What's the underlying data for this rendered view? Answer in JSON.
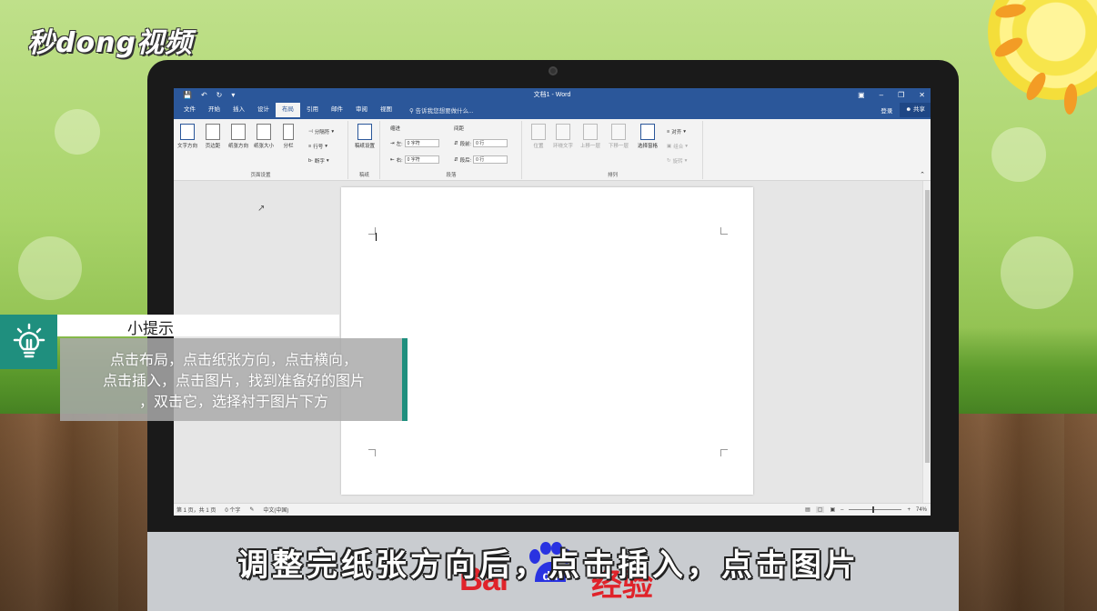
{
  "brand": {
    "logo_text": "秒dong视频"
  },
  "window": {
    "title": "文档1 - Word",
    "quick_access": [
      "save-icon",
      "undo-icon",
      "redo-icon",
      "customize-icon"
    ],
    "controls": [
      "ribbon-options-icon",
      "minimize-icon",
      "restore-icon",
      "close-icon"
    ]
  },
  "ribbon_tabs": {
    "items": [
      "文件",
      "开始",
      "插入",
      "设计",
      "布局",
      "引用",
      "邮件",
      "审阅",
      "视图"
    ],
    "active": "布局",
    "tell_me": "告诉我您想要做什么...",
    "signin": "登录",
    "share": "共享"
  },
  "ribbon": {
    "page_setup": {
      "label": "页面设置",
      "buttons": [
        "文字方向",
        "页边距",
        "纸张方向",
        "纸张大小",
        "分栏"
      ],
      "small": [
        "分隔符",
        "行号",
        "断字"
      ]
    },
    "draft": {
      "label": "稿纸",
      "button": "稿纸设置"
    },
    "paragraph": {
      "label": "段落",
      "indent_title": "缩进",
      "spacing_title": "间距",
      "indent_left_label": "左:",
      "indent_left_value": "0 字符",
      "indent_right_label": "右:",
      "indent_right_value": "0 字符",
      "before_label": "段前:",
      "before_value": "0 行",
      "after_label": "段后:",
      "after_value": "0 行"
    },
    "arrange": {
      "label": "排列",
      "buttons": [
        "位置",
        "环绕文字",
        "上移一层",
        "下移一层",
        "选择窗格"
      ],
      "small": [
        "对齐",
        "组合",
        "旋转"
      ]
    }
  },
  "statusbar": {
    "page": "第 1 页，共 1 页",
    "words": "0 个字",
    "language": "中文(中国)",
    "zoom": "74%",
    "zoom_fraction": 0.45
  },
  "tip": {
    "title": "小提示",
    "line1": "点击布局，点击纸张方向，点击横向，",
    "line2": "点击插入，点击图片，找到准备好的图片",
    "line3": "，双击它，选择衬于图片下方"
  },
  "subtitle": "调整完纸张方向后，点击插入，点击图片",
  "watermark": {
    "baidu": "Bai",
    "du": "du",
    "jingyan": "经验"
  },
  "colors": {
    "word_blue": "#2b579a",
    "tip_accent": "#1f8f7e",
    "baidu_red": "#e0232a"
  }
}
